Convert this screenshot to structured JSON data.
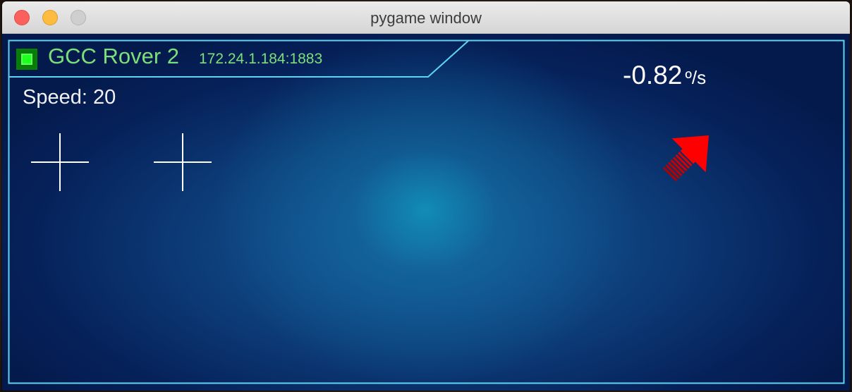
{
  "window": {
    "title": "pygame window"
  },
  "rover": {
    "name": "GCC Rover 2",
    "address": "172.24.1.184:1883",
    "status_color": "#20ff20"
  },
  "telemetry": {
    "speed_label": "Speed: 20",
    "rotation_value": "-0.82",
    "rotation_unit": "º/s",
    "arrow_direction": "up-right",
    "arrow_color": "#ff0000"
  },
  "colors": {
    "frame": "#5fd3f0",
    "text_green": "#7be07b",
    "background": "#0d3e7a"
  },
  "icons": {
    "close": "close-button",
    "minimize": "minimize-button",
    "zoom": "zoom-button",
    "status": "status-led-icon",
    "crosshair": "crosshair-icon",
    "arrow": "direction-arrow-icon"
  }
}
